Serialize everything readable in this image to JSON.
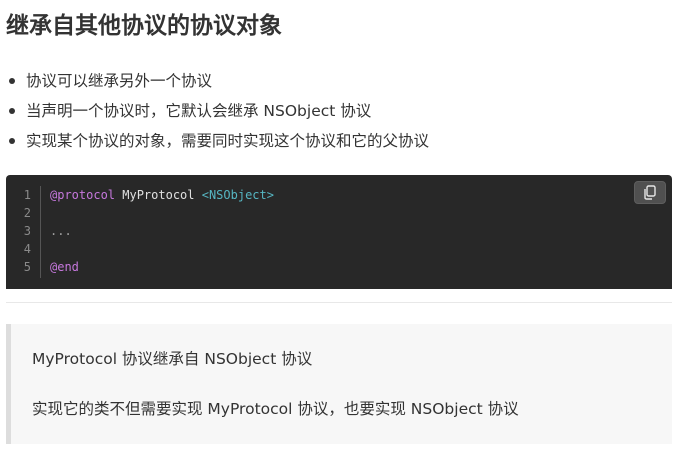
{
  "heading": "继承自其他协议的协议对象",
  "bullets": [
    "协议可以继承另外一个协议",
    "当声明一个协议时，它默认会继承 NSObject 协议",
    "实现某个协议的对象，需要同时实现这个协议和它的父协议"
  ],
  "code_block": {
    "line_numbers": [
      "1",
      "2",
      "3",
      "4",
      "5"
    ],
    "line1_keyword": "@protocol",
    "line1_name": " MyProtocol ",
    "line1_parent": "<NSObject>",
    "line3_text": "...",
    "line5_keyword": "@end",
    "copy_icon": "copy-icon",
    "colors": {
      "background": "#282828",
      "keyword": "#c678dd",
      "angle": "#56b6c2"
    }
  },
  "quote": {
    "p1": "MyProtocol 协议继承自 NSObject 协议",
    "p2": "实现它的类不但需要实现 MyProtocol 协议，也要实现 NSObject 协议"
  }
}
